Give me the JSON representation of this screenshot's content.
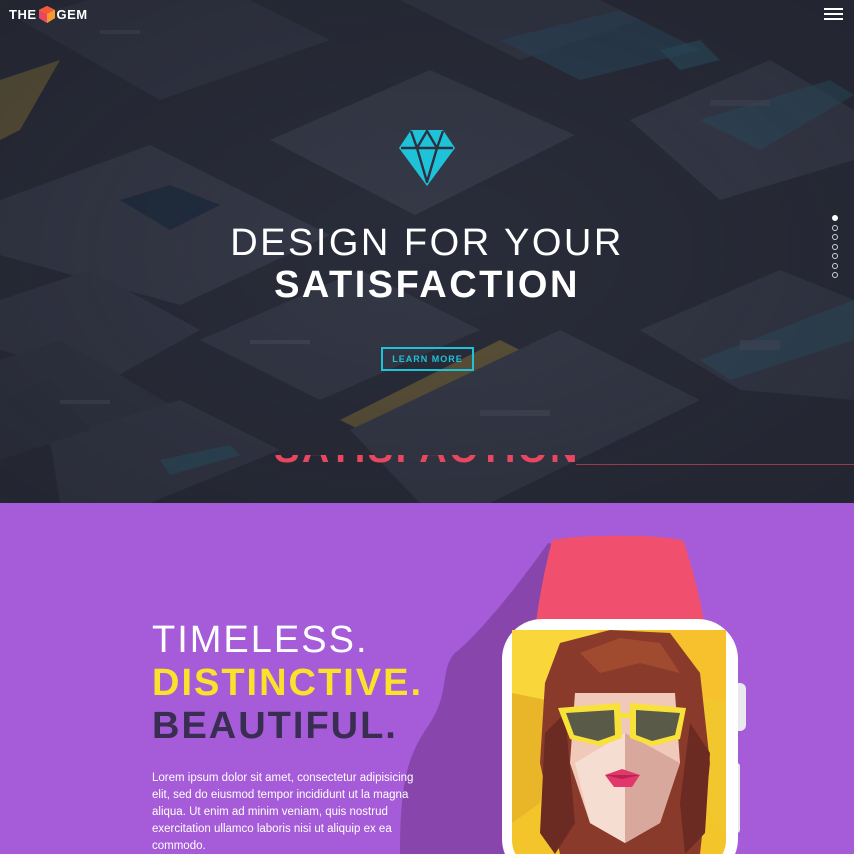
{
  "header": {
    "logo_left": "THE",
    "logo_right": "GEM",
    "menu_icon": "hamburger-menu-icon"
  },
  "hero": {
    "icon": "diamond-icon",
    "headline_line1": "DESIGN FOR YOUR",
    "headline_line2": "SATISFACTION",
    "button_label": "LEARN MORE",
    "slider_dots": 7,
    "active_dot": 1,
    "ghost_text": "SATISFACTION"
  },
  "feature": {
    "line1": "TIMELESS.",
    "line2": "DISTINCTIVE.",
    "line3": "BEAUTIFUL.",
    "body": "Lorem ipsum dolor sit amet, consectetur adipisicing elit, sed do eiusmod tempor incididunt ut la magna aliqua. Ut enim ad minim veniam, quis nostrud exercitation ullamco laboris nisi ut aliquip ex ea commodo."
  },
  "colors": {
    "accent_cyan": "#1fc3d9",
    "purple_bg": "#a65cd8",
    "yellow": "#fbe22a",
    "dark_text": "#3a2d52",
    "watch_band": "#f0506e",
    "hero_bg": "#2a2d3a"
  }
}
